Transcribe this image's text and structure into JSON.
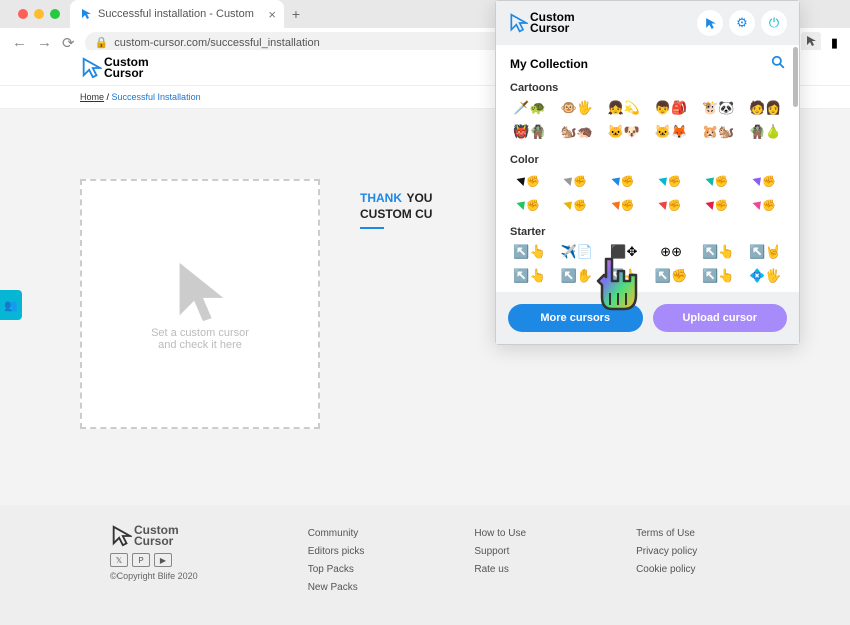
{
  "browser": {
    "tab_title": "Successful installation - Custom",
    "url": "custom-cursor.com/successful_installation"
  },
  "logo": {
    "line1": "Custom",
    "line2": "Cursor"
  },
  "breadcrumb": {
    "home": "Home",
    "sep": " / ",
    "current": "Successful Installation"
  },
  "test_box": {
    "line1": "Set a custom cursor",
    "line2": "and check it here"
  },
  "thankyou": {
    "word1": "THANK",
    "word2": "YOU",
    "line2": "CUSTOM CU"
  },
  "footer": {
    "copyright": "©Copyright Blife 2020",
    "col1": [
      "Community",
      "Editors picks",
      "Top Packs",
      "New Packs"
    ],
    "col2": [
      "How to Use",
      "Support",
      "Rate us"
    ],
    "col3": [
      "Terms of Use",
      "Privacy policy",
      "Cookie policy"
    ]
  },
  "popup": {
    "title": "My Collection",
    "categories": {
      "cartoons": {
        "label": "Cartoons",
        "items": [
          "🗡️🐢",
          "🐵🖐️",
          "👧💫",
          "👦🎒",
          "🐮🐼",
          "🧑👩",
          "👹🧌",
          "🐿️🦔",
          "🐱🐶",
          "🐱🦊",
          "🐹🐿️",
          "🧌🍐"
        ]
      },
      "color": {
        "label": "Color",
        "items": [
          {
            "c": "#111"
          },
          {
            "c": "#999"
          },
          {
            "c": "#1e88e5"
          },
          {
            "c": "#06b6d4"
          },
          {
            "c": "#14b8a6"
          },
          {
            "c": "#8b5cf6"
          },
          {
            "c": "#22c55e"
          },
          {
            "c": "#eab308"
          },
          {
            "c": "#f97316"
          },
          {
            "c": "#ef4444"
          },
          {
            "c": "#e11d48"
          },
          {
            "c": "#ec4899"
          }
        ]
      },
      "starter": {
        "label": "Starter",
        "items": [
          "↖️👆",
          "✈️📄",
          "⬛✥",
          "⊕⊕",
          "↖️👆",
          "↖️🤘",
          "↖️👆",
          "↖️✋",
          "↖️👆",
          "↖️✊",
          "↖️👆",
          "💠🖐️"
        ]
      }
    },
    "more_btn": "More cursors",
    "upload_btn": "Upload cursor"
  }
}
